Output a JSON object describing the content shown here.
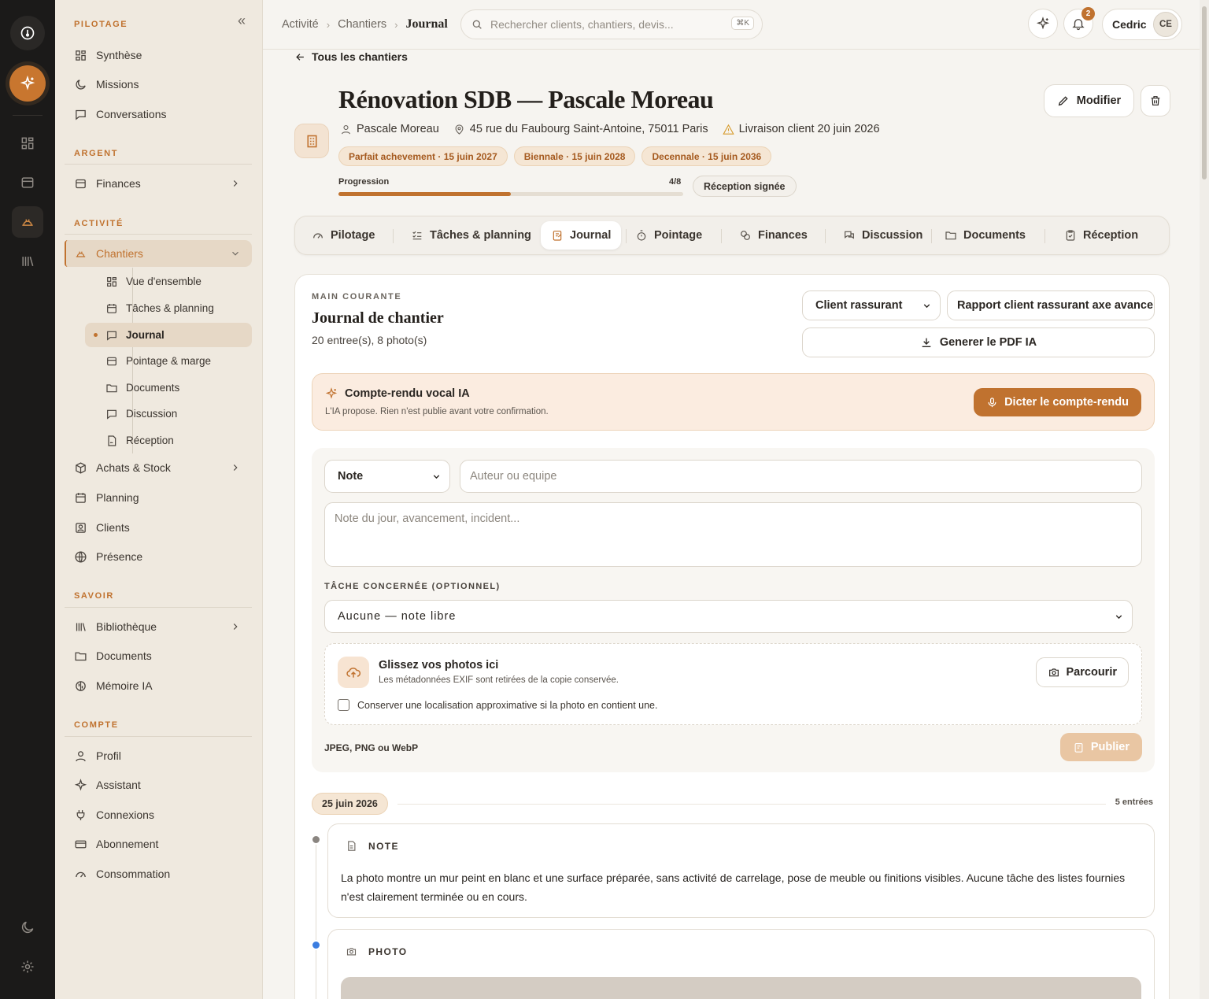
{
  "app": {
    "accent": "#c0722f"
  },
  "sidebar": {
    "collapse_icon": "«",
    "sections": {
      "pilotage": "PILOTAGE",
      "argent": "ARGENT",
      "activite": "ACTIVITÉ",
      "savoir": "SAVOIR",
      "compte": "COMPTE"
    },
    "items": {
      "synthese": "Synthèse",
      "missions": "Missions",
      "conversations": "Conversations",
      "finances": "Finances",
      "chantiers": "Chantiers",
      "achats": "Achats & Stock",
      "planning": "Planning",
      "clients": "Clients",
      "presence": "Présence",
      "bibliotheque": "Bibliothèque",
      "documents": "Documents",
      "memoire": "Mémoire IA",
      "profil": "Profil",
      "assistant": "Assistant",
      "connexions": "Connexions",
      "abonnement": "Abonnement",
      "consommation": "Consommation"
    },
    "sub": {
      "vue": "Vue d'ensemble",
      "taches": "Tâches & planning",
      "journal": "Journal",
      "pointage": "Pointage & marge",
      "documents": "Documents",
      "discussion": "Discussion",
      "reception": "Réception"
    }
  },
  "topbar": {
    "crumbs": [
      "Activité",
      "Chantiers",
      "Journal"
    ],
    "search_placeholder": "Rechercher clients, chantiers, devis...",
    "search_kbd": "⌘K",
    "notif_count": "2",
    "user_name": "Cedric",
    "user_initials": "CE"
  },
  "header": {
    "back_label": "Tous les chantiers",
    "title": "Rénovation SDB — Pascale Moreau",
    "client": "Pascale Moreau",
    "address": "45 rue du Faubourg Saint-Antoine, 75011 Paris",
    "delivery": "Livraison client 20 juin 2026",
    "warranties": [
      "Parfait achevement · 15 juin 2027",
      "Biennale · 15 juin 2028",
      "Decennale · 15 juin 2036"
    ],
    "progress_label": "Progression",
    "progress_text": "4/8",
    "progress_value": 0.5,
    "reception_badge": "Réception signée",
    "edit_label": "Modifier"
  },
  "tabs": [
    "Pilotage",
    "Tâches & planning",
    "Journal",
    "Pointage",
    "Finances",
    "Discussion",
    "Documents",
    "Réception"
  ],
  "journal": {
    "eyebrow": "MAIN COURANTE",
    "title": "Journal de chantier",
    "summary": "20 entree(s), 8 photo(s)",
    "tone_select": "Client rassurant",
    "report_select": "Rapport client rassurant axe avancement",
    "pdf_label": "Generer le PDF IA",
    "ai": {
      "title": "Compte-rendu vocal IA",
      "subtitle": "L'IA propose. Rien n'est publie avant votre confirmation.",
      "button": "Dicter le compte-rendu"
    },
    "form": {
      "type_value": "Note",
      "author_placeholder": "Auteur ou equipe",
      "note_placeholder": "Note du jour, avancement, incident...",
      "task_label": "TÂCHE CONCERNÉE (OPTIONNEL)",
      "task_value": "Aucune — note libre",
      "drop_title": "Glissez vos photos ici",
      "drop_sub": "Les métadonnées EXIF sont retirées de la copie conservée.",
      "drop_check": "Conserver une localisation approximative si la photo en contient une.",
      "browse_label": "Parcourir",
      "formats": "JPEG, PNG ou WebP",
      "publish_label": "Publier"
    },
    "date_group": {
      "date": "25 juin 2026",
      "count": "5 entrées"
    },
    "entries": [
      {
        "type": "NOTE",
        "text": "La photo montre un mur peint en blanc et une surface préparée, sans activité de carrelage, pose de meuble ou finitions visibles. Aucune tâche des listes fournies n'est clairement terminée ou en cours.",
        "dot": "#8a8580"
      },
      {
        "type": "PHOTO",
        "text": "",
        "dot": "#3b7de0"
      }
    ]
  }
}
